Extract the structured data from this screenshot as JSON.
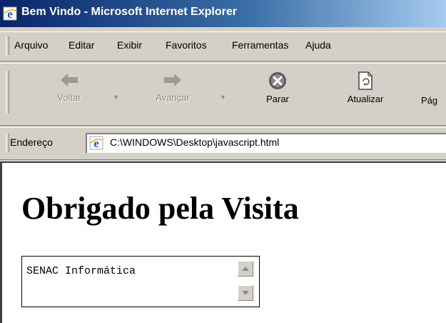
{
  "window": {
    "title": "Bem Vindo - Microsoft Internet Explorer"
  },
  "menu": [
    "Arquivo",
    "Editar",
    "Exibir",
    "Favoritos",
    "Ferramentas",
    "Ajuda"
  ],
  "toolbar": {
    "back_label": "Voltar",
    "forward_label": "Avançar",
    "stop_label": "Parar",
    "refresh_label": "Atualizar",
    "home_label": "Pág"
  },
  "address": {
    "label": "Endereço",
    "url": "C:\\WINDOWS\\Desktop\\javascript.html"
  },
  "page": {
    "heading": "Obrigado pela Visita",
    "textarea_value": "SENAC Informática"
  },
  "colors": {
    "titlebar_start": "#0a246a",
    "titlebar_end": "#a6caf0",
    "chrome": "#d4d0c8"
  },
  "icons": [
    "ie-logo-icon",
    "back-arrow-icon",
    "forward-arrow-icon",
    "stop-icon",
    "refresh-icon",
    "dropdown-arrow-icon",
    "scroll-up-icon",
    "scroll-down-icon"
  ]
}
